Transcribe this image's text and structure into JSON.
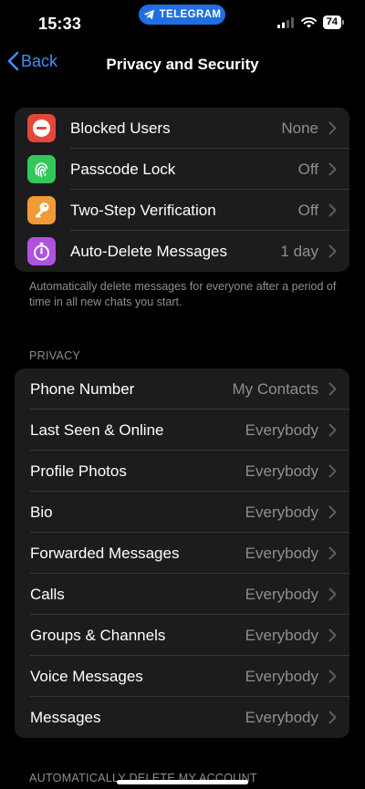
{
  "status": {
    "time": "15:33",
    "pill_label": "TELEGRAM",
    "battery": "74"
  },
  "nav": {
    "back_label": "Back",
    "title": "Privacy and Security"
  },
  "security": {
    "items": [
      {
        "label": "Blocked Users",
        "value": "None",
        "icon": "minus-circle-icon",
        "color": "#e5473a"
      },
      {
        "label": "Passcode Lock",
        "value": "Off",
        "icon": "fingerprint-icon",
        "color": "#34c759"
      },
      {
        "label": "Two-Step Verification",
        "value": "Off",
        "icon": "key-icon",
        "color": "#f19a38"
      },
      {
        "label": "Auto-Delete Messages",
        "value": "1 day",
        "icon": "timer-icon",
        "color": "#af52de"
      }
    ],
    "footnote": "Automatically delete messages for everyone after a period of time in all new chats you start."
  },
  "privacy": {
    "header": "PRIVACY",
    "items": [
      {
        "label": "Phone Number",
        "value": "My Contacts"
      },
      {
        "label": "Last Seen & Online",
        "value": "Everybody"
      },
      {
        "label": "Profile Photos",
        "value": "Everybody"
      },
      {
        "label": "Bio",
        "value": "Everybody"
      },
      {
        "label": "Forwarded Messages",
        "value": "Everybody"
      },
      {
        "label": "Calls",
        "value": "Everybody"
      },
      {
        "label": "Groups & Channels",
        "value": "Everybody"
      },
      {
        "label": "Voice Messages",
        "value": "Everybody"
      },
      {
        "label": "Messages",
        "value": "Everybody"
      }
    ]
  },
  "next_section_header": "AUTOMATICALLY DELETE MY ACCOUNT"
}
